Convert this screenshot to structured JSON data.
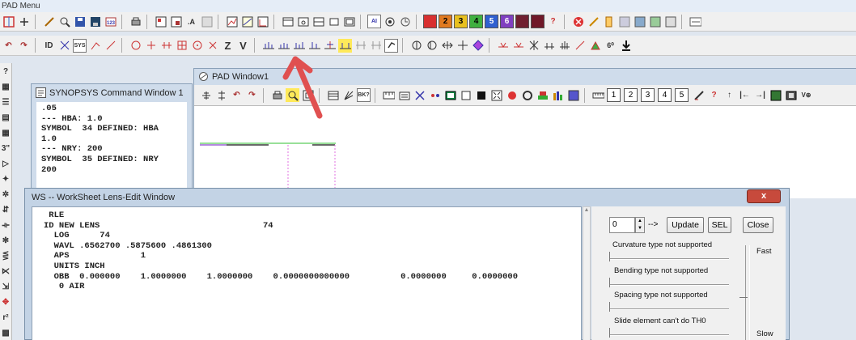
{
  "app": {
    "menu_title": "PAD Menu"
  },
  "colors": {
    "annotation_arrow": "#e05050",
    "close_red": "#c74a3c",
    "title_bg": "#cfdceb"
  },
  "toolbar1": {
    "numbered_buttons": [
      "1",
      "2",
      "3",
      "4",
      "5",
      "6"
    ],
    "icons": [
      "split-icon",
      "tree-icon",
      "draw-icon",
      "magnify-icon",
      "save-icon",
      "save-as-icon",
      "calc-icon",
      "print-icon",
      "copy-icon",
      "paste-icon",
      "text-icon",
      "grid-icon",
      "chart-icon",
      "chart2-icon",
      "plot-icon",
      "window-icon",
      "window2-icon",
      "window3-icon",
      "window4-icon",
      "window5-icon",
      "ai-icon",
      "target-icon",
      "clock-icon",
      "help-icon",
      "stop-icon",
      "tools-icon",
      "book-icon",
      "layout-icon",
      "image-icon",
      "config-icon",
      "panel-icon"
    ]
  },
  "toolbar2": {
    "text_buttons": [
      "ID",
      "SYS",
      "Z",
      "V"
    ],
    "icons": [
      "undo-icon",
      "redo-icon",
      "sys-icon",
      "ray-icon",
      "ray2-icon",
      "lens-icon",
      "lens2-icon",
      "lens3-icon",
      "circle-icon",
      "cross-icon",
      "lens-group-icon-1",
      "lens-group-icon-2",
      "lens-group-icon-3",
      "lens-group-icon-4",
      "lens-group-icon-5",
      "lens-group-icon-6",
      "bar-icon",
      "bar2-icon",
      "check-icon",
      "aperture-icon",
      "aperture2-icon",
      "arrow-icon",
      "cross2-icon",
      "diamond-icon",
      "lens-shape-1",
      "lens-shape-2",
      "lens-shape-3",
      "lens-shape-4",
      "lens-shape-5",
      "ray-line-icon",
      "lamp-icon",
      "image-plane-icon",
      "down-arrow-icon"
    ]
  },
  "left_toolbar": {
    "labels": [
      "?",
      "",
      "",
      "",
      "",
      "3\"",
      "",
      "",
      "",
      "",
      "",
      "",
      "",
      "",
      "",
      "",
      "",
      "",
      ""
    ]
  },
  "command_window": {
    "title": "SYNOPSYS Command Window 1",
    "lines": [
      ".05",
      "--- HBA: 1.0",
      "SYMBOL  34 DEFINED: HBA",
      "1.0",
      "--- NRY: 200",
      "SYMBOL  35 DEFINED: NRY",
      "200"
    ]
  },
  "pad_window": {
    "title": "PAD Window1",
    "number_tabs": [
      "1",
      "2",
      "3",
      "4",
      "5"
    ]
  },
  "worksheet": {
    "title": "WS -- WorkSheet Lens-Edit Window",
    "lines": [
      " RLE",
      "ID NEW LENS                                74",
      "  LOG      74",
      "  WAVL .6562700 .5875600 .4861300",
      "  APS              1",
      "  UNITS INCH",
      "  OBB  0.000000    1.0000000    1.0000000    0.0000000000000          0.0000000     0.0000000",
      "   0 AIR"
    ],
    "spinner_value": "0",
    "arrow_text": "-->",
    "update_label": "Update",
    "sel_label": "SEL",
    "close_label": "Close",
    "sliders": [
      "Curvature type not supported",
      "Bending  type not supported",
      "Spacing type not supported",
      "Slide element   can't do TH0"
    ],
    "fast_label": "Fast",
    "slow_label": "Slow",
    "close_x": "x"
  }
}
